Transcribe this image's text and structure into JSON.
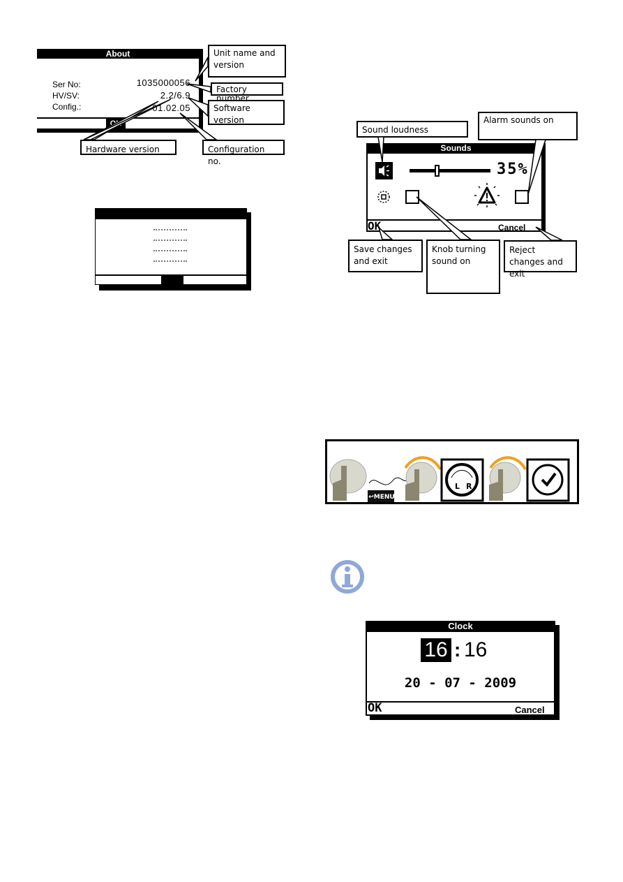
{
  "about_figure": {
    "title": "About",
    "labels": [
      "Ser No:",
      "HV/SV:",
      "Config.:"
    ],
    "values": [
      "1035000056",
      "2.2/6.9",
      "01.02.05"
    ],
    "ok_label": "OK",
    "callouts": {
      "unit_name": "Unit name and version",
      "factory_number": "Factory number",
      "software_version": "Software version",
      "hardware_version": "Hardware version",
      "configuration": "Configuration no."
    }
  },
  "blank_dialog": {
    "rows": 4
  },
  "sounds_figure": {
    "title": "Sounds",
    "volume_percent": 35,
    "volume_label": "35%",
    "knob_sound_on": false,
    "alarm_sound_on": false,
    "ok_label": "OK",
    "cancel_label": "Cancel",
    "icons": [
      "speaker-icon",
      "knob-icon",
      "alarm-icon"
    ],
    "callouts": {
      "sound_loudness": "Sound loudness",
      "alarm_sounds": "Alarm sounds on",
      "save": "Save changes and exit",
      "knob_sound": "Knob turning sound on",
      "reject": "Reject changes and exit"
    }
  },
  "knob_sequence": {
    "menu_label": "MENU",
    "dial_letters": [
      "L",
      "R"
    ],
    "arrow_color": "#f0a020"
  },
  "info_icon": {
    "color": "#8fa8d8"
  },
  "clock_figure": {
    "title": "Clock",
    "hours": "16",
    "separator": ":",
    "minutes": "16",
    "date": "20 - 07 - 2009",
    "ok_label": "OK",
    "cancel_label": "Cancel"
  }
}
